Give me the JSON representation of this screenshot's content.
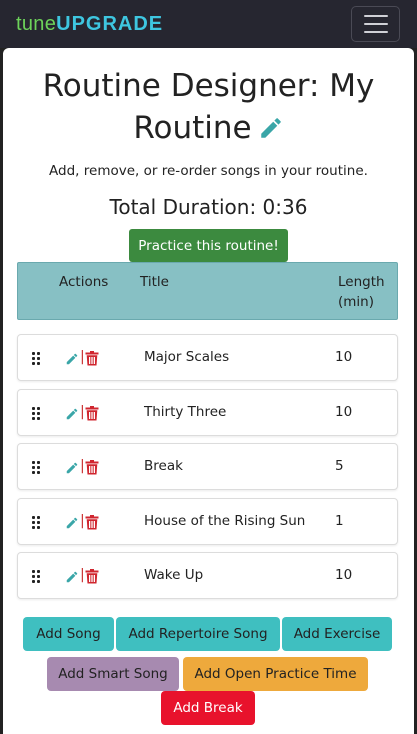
{
  "navbar": {
    "brand_part1": "tune",
    "brand_part2": "UPGRADE",
    "menu_icon": "hamburger-menu-icon"
  },
  "header": {
    "title": "Routine Designer: My Routine",
    "subtitle": "Add, remove, or re-order songs in your routine.",
    "duration": "Total Duration: 0:36",
    "practice_label": "Practice this routine!"
  },
  "table": {
    "columns": [
      "Actions",
      "Title",
      "Length (min)"
    ],
    "rows": [
      {
        "title": "Major Scales",
        "length": "10"
      },
      {
        "title": "Thirty Three",
        "length": "10"
      },
      {
        "title": "Break",
        "length": "5"
      },
      {
        "title": "House of the Rising Sun",
        "length": "1"
      },
      {
        "title": "Wake Up",
        "length": "10"
      }
    ]
  },
  "actions": {
    "add_song": "Add Song",
    "add_repertoire": "Add Repertoire Song",
    "add_exercise": "Add Exercise",
    "add_smart": "Add Smart Song",
    "add_open": "Add Open Practice Time",
    "add_break": "Add Break"
  },
  "colors": {
    "accent_teal": "#3fbfc0",
    "header_teal": "#87c0c4",
    "practice_green": "#3c8a3f",
    "smart_purple": "#a78ab0",
    "open_orange": "#eea93c",
    "break_red": "#e8122c",
    "delete_red": "#c92e2e",
    "edit_teal": "#3aa6a8"
  }
}
